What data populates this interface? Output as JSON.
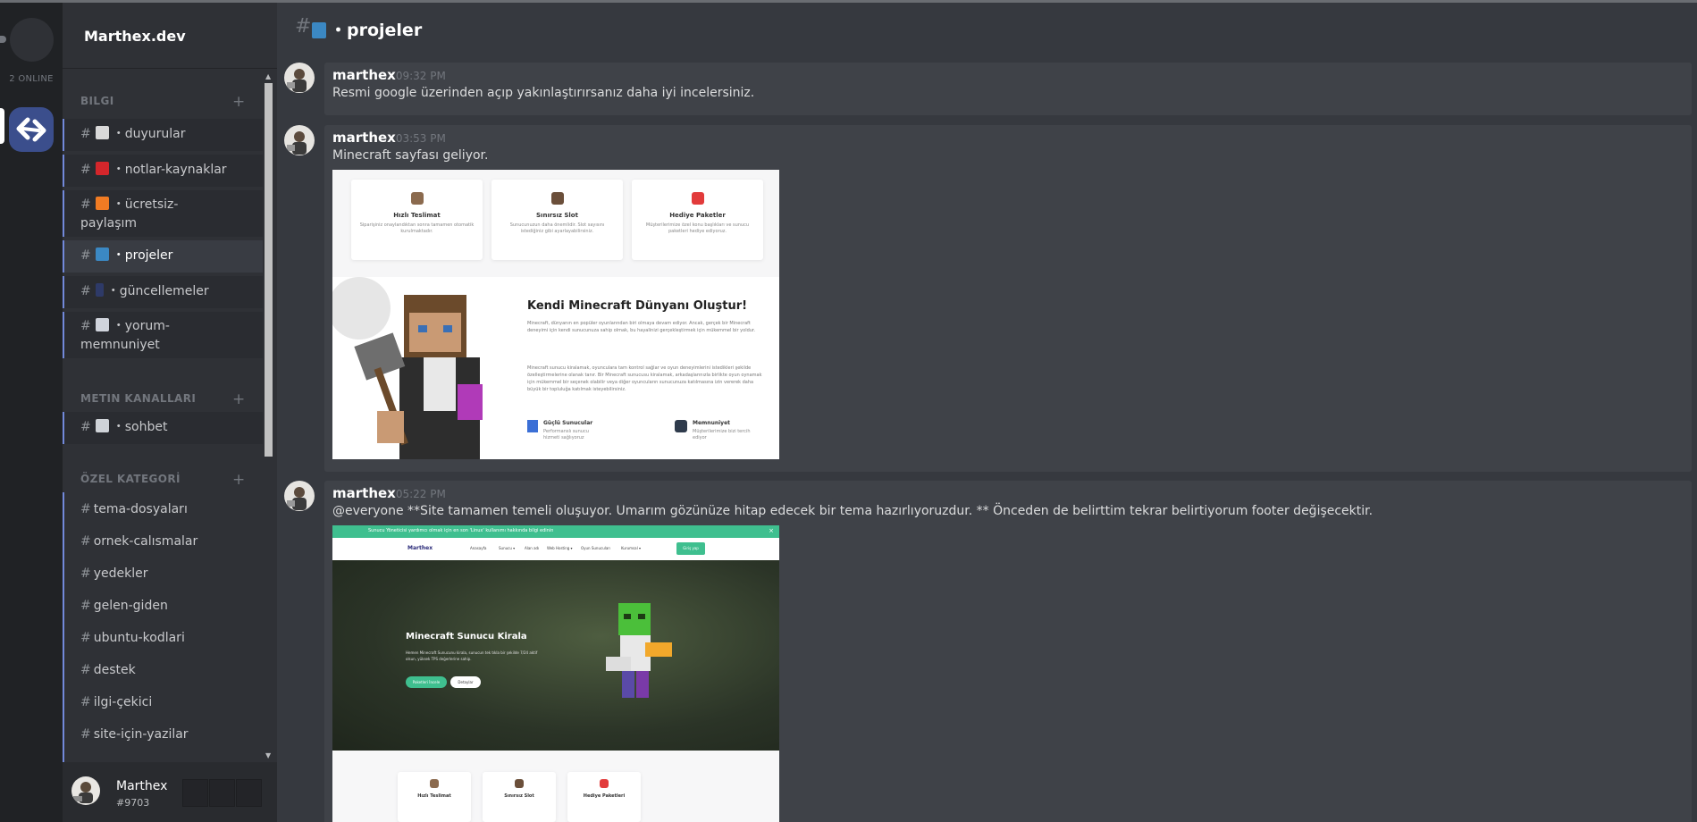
{
  "server": {
    "name": "Marthex.dev",
    "online_label": "2 ONLINE"
  },
  "categories": [
    {
      "name": "BILGI",
      "add": "+"
    },
    {
      "name": "METIN KANALLARI",
      "add": "+"
    },
    {
      "name": "ÖZEL KATEGORİ",
      "add": "+"
    }
  ],
  "channels_info": [
    {
      "emoji_color": "#d9d9d9",
      "label": "・duyurular"
    },
    {
      "emoji_color": "#d4262b",
      "label": "・notlar-kaynaklar"
    },
    {
      "emoji_color": "#f07b23",
      "label": "・ücretsiz-",
      "label2": "paylaşım"
    },
    {
      "emoji_color": "#3b88c3",
      "label": "・projeler"
    },
    {
      "emoji_color": "#2e3a68",
      "label": "・güncellemeler"
    },
    {
      "emoji_color": "#d0d4dc",
      "label": "・yorum-",
      "label2": "memnuniyet"
    }
  ],
  "channels_text": [
    {
      "emoji_color": "#cfd3d8",
      "label": "・sohbet"
    }
  ],
  "channels_special": [
    "tema-dosyaları",
    "ornek-calısmalar",
    "yedekler",
    "gelen-giden",
    "ubuntu-kodlari",
    "destek",
    "ilgi-çekici",
    "site-için-yazilar"
  ],
  "hash": "#",
  "user": {
    "name": "Marthex",
    "tag": "#9703"
  },
  "header": {
    "hash": "#",
    "title": "・projeler"
  },
  "messages": [
    {
      "author": "marthex",
      "time": "09:32 PM",
      "text": "Resmi google üzerinden açıp yakınlaştırırsanız daha iyi incelersiniz."
    },
    {
      "author": "marthex",
      "time": "03:53 PM",
      "text": "Minecraft sayfası geliyor."
    },
    {
      "author": "marthex",
      "time": "05:22 PM",
      "text": "@everyone **Site tamamen temeli oluşuyor. Umarım gözünüze hitap edecek bir tema hazırlıyoruzdur. ** Önceden de belirttim tekrar belirtiyorum footer değişecektir."
    }
  ],
  "shot1": {
    "cards": [
      {
        "title": "Hızlı Teslimat",
        "desc": "Siparişiniz onaylandıktan sonra tamamen otomatik kurulmaktadır.",
        "icon_color": "#8b6a4e"
      },
      {
        "title": "Sınırsız Slot",
        "desc": "Sunucunuzun daha önemlidir. Slot sayısını istediğiniz gibi ayarlayabilirsiniz.",
        "icon_color": "#6b4f3a"
      },
      {
        "title": "Hediye Paketler",
        "desc": "Müşterilerimize özel konu başlıkları ve sunucu paketleri hediye ediyoruz.",
        "icon_color": "#e23b3b"
      }
    ],
    "heading": "Kendi Minecraft Dünyanı Oluştur!",
    "para1": "Minecraft, dünyanın en popüler oyunlarından biri olmaya devam ediyor. Ancak, gerçek bir Minecraft deneyimi için kendi sunucunuza sahip olmak, bu hayalinizi gerçekleştirmek için mükemmel bir yoldur.",
    "para2": "Minecraft sunucu kiralamak, oyunculara tam kontrol sağlar ve oyun deneyimlerini istedikleri şekilde özelleştirmelerine olanak tanır. Bir Minecraft sunucusu kiralamak, arkadaşlarınızla birlikte oyun oynamak için mükemmel bir seçenek olabilir veya diğer oyuncuların sunucunuza katılmasına izin vererek daha büyük bir topluluğa katılmak isteyebilirsiniz.",
    "feat1_title": "Güçlü Sunucular",
    "feat1_desc": "Performanslı sunucu hizmeti sağlıyoruz",
    "feat2_title": "Memnuniyet",
    "feat2_desc": "Müşterilerimize bizi tercih ediyor"
  },
  "shot2": {
    "topbar": "Sunucu Yöneticisi yardımcı olmak için en son 'Linux' kullanımı hakkında bilgi edinin",
    "brand": "Marthex",
    "nav": [
      "Anasayfa",
      "Sunucu ▾",
      "Alan adı",
      "Web Hosting ▾",
      "Oyun Sunucuları",
      "Kurumsal ▾"
    ],
    "nav_btn": "Giriş yap",
    "hero_title": "Minecraft Sunucu Kirala",
    "hero_desc": "Hemen Minecraft Sunucunu kirala, sunucun tek tıkla bir şekilde 7/24 aktif olsun, yüksek TPS değerlerine sahip.",
    "btn1": "Paketleri İncele",
    "btn2": "Detaylar",
    "cards": [
      {
        "title": "Hızlı Teslimat",
        "icon_color": "#8b6a4e"
      },
      {
        "title": "Sınırsız Slot",
        "icon_color": "#6b4f3a"
      },
      {
        "title": "Hediye Paketleri",
        "icon_color": "#e23b3b"
      }
    ]
  },
  "colors": {
    "accent": "#7289da",
    "brand_server": "#3b4e8c",
    "green_btn": "#3fbf8f"
  }
}
